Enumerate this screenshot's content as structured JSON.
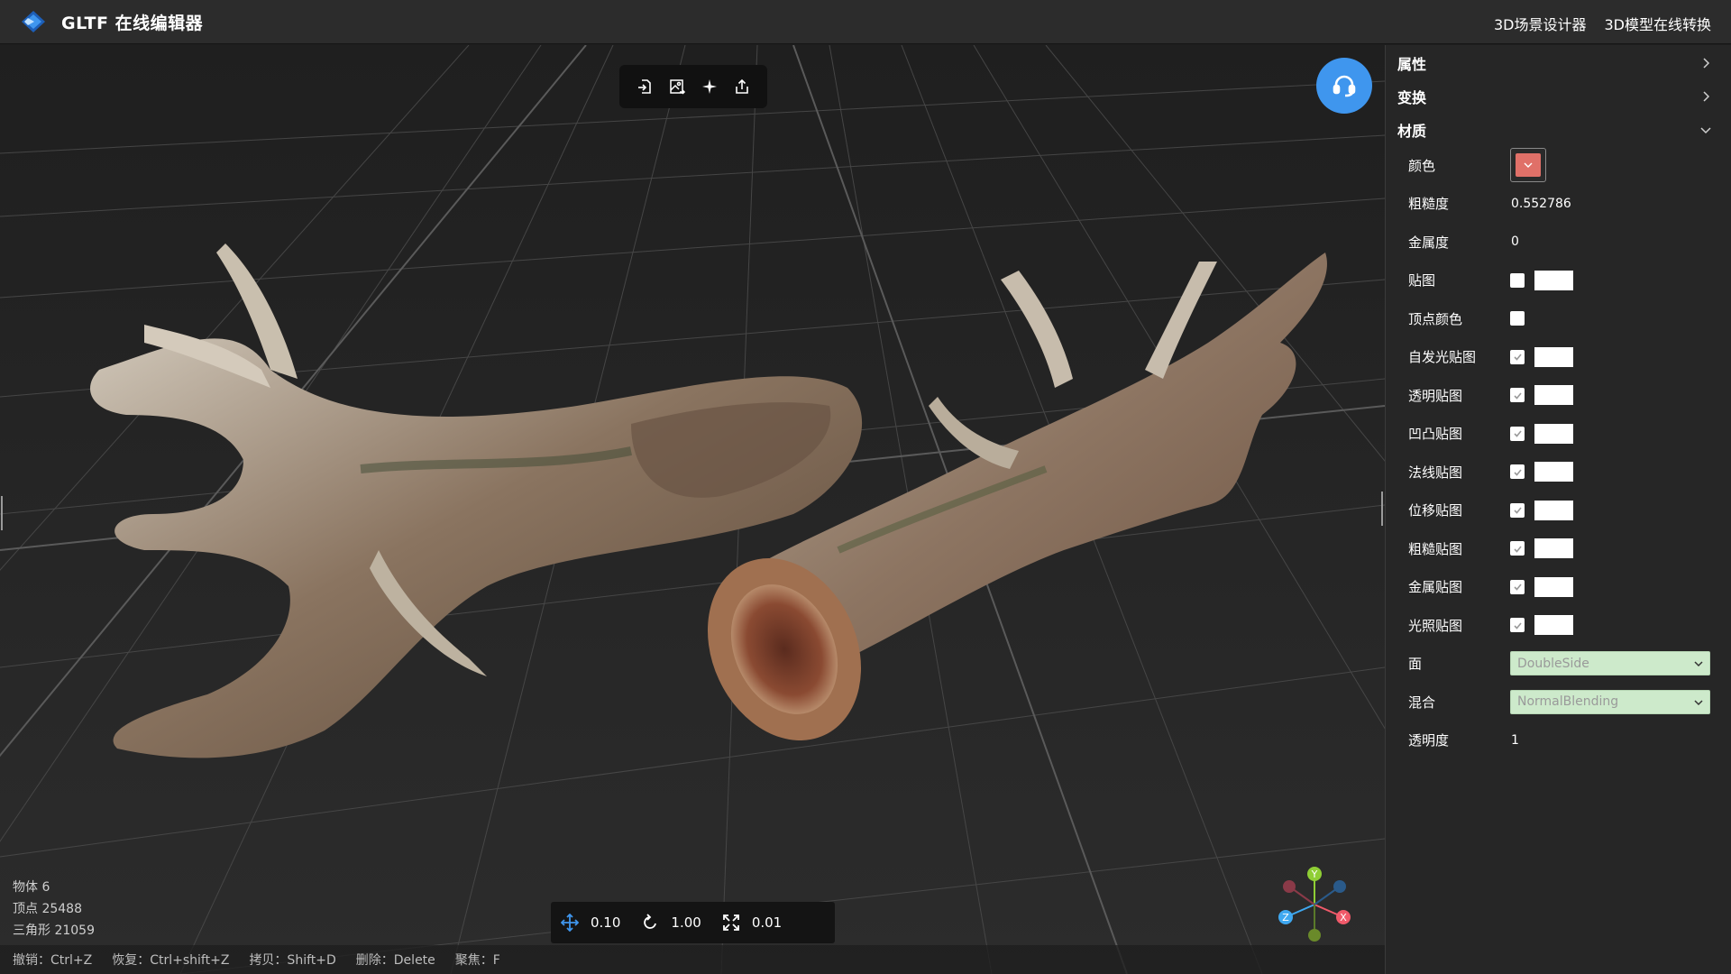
{
  "app": {
    "title": "GLTF 在线编辑器"
  },
  "header": {
    "links": [
      "3D场景设计器",
      "3D模型在线转换"
    ]
  },
  "toolbar": {
    "icons": [
      "import-icon",
      "image-export-icon",
      "light-icon",
      "upload-icon"
    ]
  },
  "stats": {
    "objects": "物体 6",
    "vertices": "顶点 25488",
    "triangles": "三角形 21059"
  },
  "transform": {
    "move": "0.10",
    "rotate": "1.00",
    "scale": "0.01"
  },
  "shortcuts": [
    "撤销：Ctrl+Z",
    "恢复：Ctrl+shift+Z",
    "拷贝：Shift+D",
    "删除：Delete",
    "聚焦：F"
  ],
  "gizmo": {
    "y": "Y",
    "x": "X",
    "z": "Z"
  },
  "panel": {
    "sections": {
      "properties": "属性",
      "transform": "变换",
      "material": "材质"
    },
    "material": {
      "color_label": "颜色",
      "color_value": "#e07068",
      "roughness_label": "粗糙度",
      "roughness": "0.552786",
      "metalness_label": "金属度",
      "metalness": "0",
      "maps": [
        {
          "label": "贴图",
          "checked": false,
          "slot": true
        },
        {
          "label": "顶点颜色",
          "checked": false,
          "slot": false
        },
        {
          "label": "自发光贴图",
          "checked": true,
          "slot": true
        },
        {
          "label": "透明贴图",
          "checked": true,
          "slot": true
        },
        {
          "label": "凹凸贴图",
          "checked": true,
          "slot": true
        },
        {
          "label": "法线贴图",
          "checked": true,
          "slot": true
        },
        {
          "label": "位移贴图",
          "checked": true,
          "slot": true
        },
        {
          "label": "粗糙贴图",
          "checked": true,
          "slot": true
        },
        {
          "label": "金属贴图",
          "checked": true,
          "slot": true
        },
        {
          "label": "光照贴图",
          "checked": true,
          "slot": true
        }
      ],
      "side_label": "面",
      "side": "DoubleSide",
      "blending_label": "混合",
      "blending": "NormalBlending",
      "opacity_label": "透明度",
      "opacity": "1"
    }
  },
  "colors": {
    "accent": "#3f96ee",
    "topbar": "#2c2c2c",
    "panel": "#262626",
    "select_bg": "#cdeacb"
  }
}
